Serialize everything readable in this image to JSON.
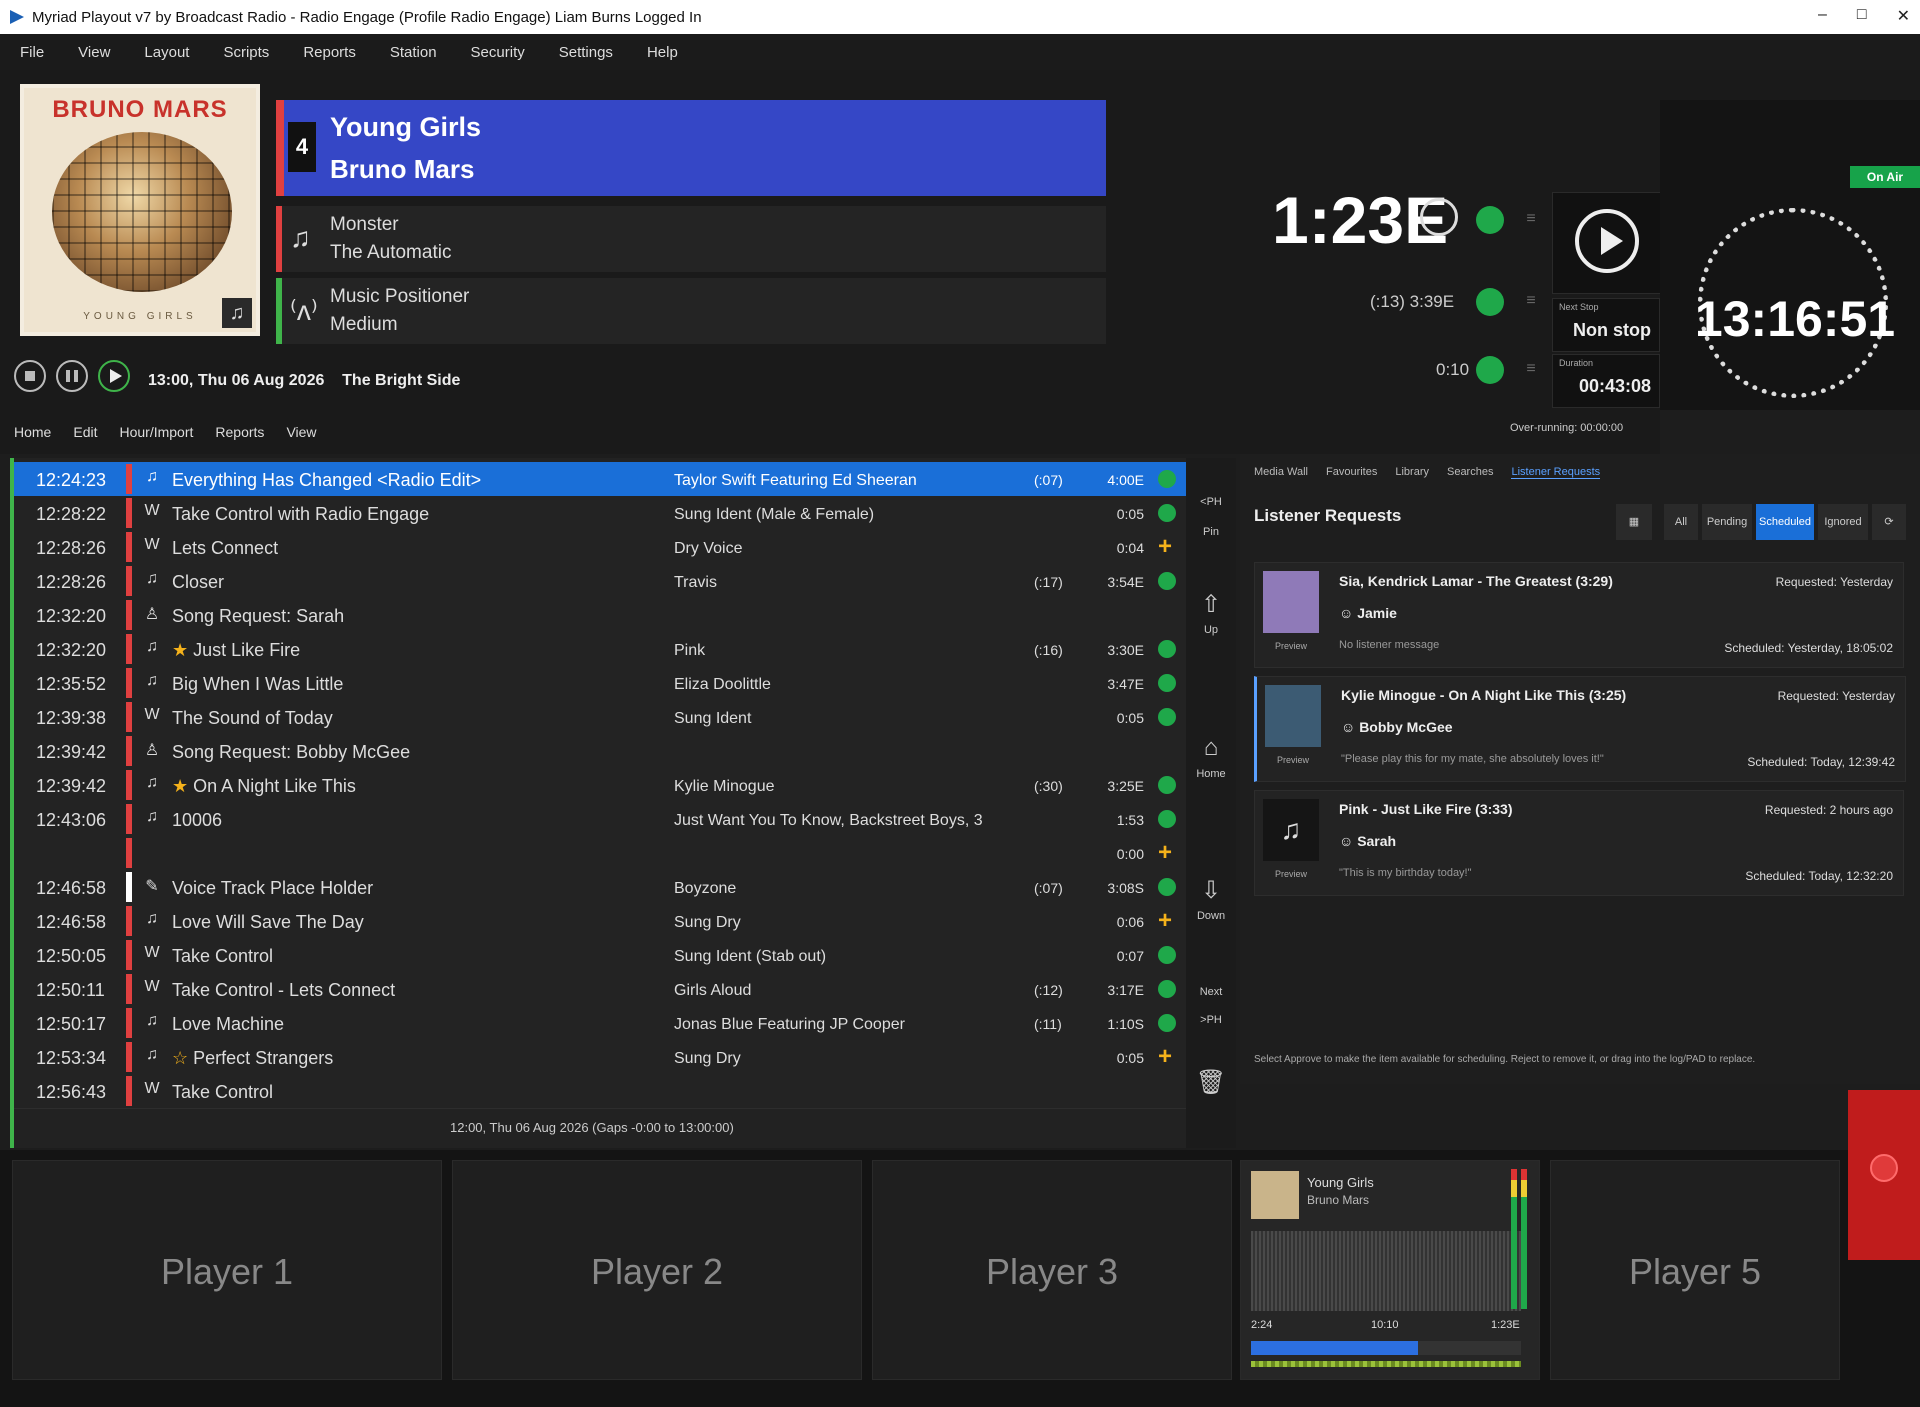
{
  "window": {
    "title": "Myriad Playout v7 by Broadcast Radio - Radio Engage (Profile Radio Engage) Liam Burns Logged In",
    "controls": [
      "–",
      "□",
      "✕"
    ]
  },
  "menu": [
    "File",
    "View",
    "Layout",
    "Scripts",
    "Reports",
    "Station",
    "Security",
    "Settings",
    "Help"
  ],
  "on_air": "On Air",
  "now_playing": {
    "album_artist": "BRUNO MARS",
    "album_sub": "YOUNG GIRLS",
    "number": "4",
    "title": "Young Girls",
    "artist": "Bruno Mars",
    "time": "1:23E",
    "next1_title": "Monster",
    "next1_sub": "The Automatic",
    "next2_title": "Music Positioner",
    "next2_sub": "Medium",
    "next1_time": "(:13) 3:39E",
    "next2_time": "0:10",
    "next_stop_label": "Next Stop",
    "next_stop": "Non stop",
    "duration_label": "Duration",
    "duration": "00:43:08",
    "clock": "13:16:51",
    "schedule_line": "13:00, Thu 06 Aug 2026",
    "show_name": "The Bright Side",
    "over_running": "Over-running: 00:00:00"
  },
  "ribbon": [
    "Home",
    "Edit",
    "Hour/Import",
    "Reports",
    "View"
  ],
  "log": {
    "rows": [
      {
        "time": "12:24:23",
        "color": "#e04040",
        "icon": "♫",
        "title": "Everything Has Changed <Radio Edit>",
        "artist": "Taylor Swift Featuring Ed Sheeran",
        "intro": "(:07)",
        "dur": "4:00E",
        "status": "green",
        "selected": true
      },
      {
        "time": "12:28:22",
        "color": "#e04040",
        "icon": "W",
        "title": "Take Control with Radio Engage",
        "artist": "Sung Ident (Male & Female)",
        "intro": "",
        "dur": "0:05",
        "status": "green"
      },
      {
        "time": "12:28:26",
        "color": "#e04040",
        "icon": "W",
        "title": "Lets Connect",
        "artist": "Dry Voice",
        "intro": "",
        "dur": "0:04",
        "status": "plus"
      },
      {
        "time": "12:28:26",
        "color": "#e04040",
        "icon": "♫",
        "title": "Closer",
        "artist": "Travis",
        "intro": "(:17)",
        "dur": "3:54E",
        "status": "green"
      },
      {
        "time": "12:32:20",
        "color": "#e04040",
        "icon": "♙",
        "title": "Song Request: Sarah",
        "artist": "",
        "intro": "",
        "dur": "",
        "status": ""
      },
      {
        "time": "12:32:20",
        "color": "#e04040",
        "icon": "♫",
        "title": "Just Like Fire",
        "star": "★",
        "artist": "Pink",
        "intro": "(:16)",
        "dur": "3:30E",
        "status": "green"
      },
      {
        "time": "12:35:52",
        "color": "#e04040",
        "icon": "♫",
        "title": "Big When I Was Little",
        "artist": "Eliza Doolittle",
        "intro": "",
        "dur": "3:47E",
        "status": "green"
      },
      {
        "time": "12:39:38",
        "color": "#e04040",
        "icon": "W",
        "title": "The Sound of Today",
        "artist": "Sung Ident",
        "intro": "",
        "dur": "0:05",
        "status": "green"
      },
      {
        "time": "12:39:42",
        "color": "#e04040",
        "icon": "♙",
        "title": "Song Request: Bobby McGee",
        "artist": "",
        "intro": "",
        "dur": "",
        "status": ""
      },
      {
        "time": "12:39:42",
        "color": "#e04040",
        "icon": "♫",
        "title": "On A Night Like This",
        "star": "★",
        "artist": "Kylie Minogue",
        "intro": "(:30)",
        "dur": "3:25E",
        "status": "green"
      },
      {
        "time": "12:43:06",
        "color": "#e04040",
        "icon": "♫",
        "title": "10006",
        "artist": "Just Want You To Know, Backstreet Boys, 3",
        "intro": "",
        "dur": "1:53",
        "status": "green"
      },
      {
        "time": "",
        "color": "#e04040",
        "icon": "",
        "title": "",
        "artist": "",
        "intro": "",
        "dur": "0:00",
        "status": "plus"
      },
      {
        "time": "12:46:58",
        "color": "#ffffff",
        "icon": "✎",
        "title": "Voice Track Place Holder",
        "artist": "Boyzone",
        "intro": "(:07)",
        "dur": "3:08S",
        "status": "green"
      },
      {
        "time": "12:46:58",
        "color": "#e04040",
        "icon": "♫",
        "title": "Love Will Save The Day",
        "artist": "Sung Dry",
        "intro": "",
        "dur": "0:06",
        "status": "plus"
      },
      {
        "time": "12:50:05",
        "color": "#e04040",
        "icon": "W",
        "title": "Take Control",
        "artist": "Sung Ident (Stab out)",
        "intro": "",
        "dur": "0:07",
        "status": "green"
      },
      {
        "time": "12:50:11",
        "color": "#e04040",
        "icon": "W",
        "title": "Take Control - Lets Connect",
        "artist": "Girls Aloud",
        "intro": "(:12)",
        "dur": "3:17E",
        "status": "green"
      },
      {
        "time": "12:50:17",
        "color": "#e04040",
        "icon": "♫",
        "title": "Love Machine",
        "artist": "Jonas Blue Featuring JP Cooper",
        "intro": "(:11)",
        "dur": "1:10S",
        "status": "green"
      },
      {
        "time": "12:53:34",
        "color": "#e04040",
        "icon": "♫",
        "title": "Perfect Strangers",
        "star": "☆",
        "artist": "Sung Dry",
        "intro": "",
        "dur": "0:05",
        "status": "plus"
      },
      {
        "time": "12:56:43",
        "color": "#e04040",
        "icon": "W",
        "title": "Take Control",
        "artist": "",
        "intro": "",
        "dur": "",
        "status": ""
      }
    ],
    "footer": "12:00, Thu 06 Aug 2026 (Gaps -0:00 to 13:00:00)"
  },
  "side_controls": {
    "prev": "<PH",
    "pin": "Pin",
    "up": "Up",
    "home": "Home",
    "down": "Down",
    "next": "Next",
    "end": ">PH"
  },
  "requests": {
    "tabs": [
      "Media Wall",
      "Favourites",
      "Library",
      "Searches",
      "Listener Requests"
    ],
    "header": "Listener Requests",
    "filters": [
      "All",
      "Pending",
      "Scheduled",
      "Ignored"
    ],
    "cards": [
      {
        "title": "Sia, Kendrick Lamar - The Greatest (3:29)",
        "user": "Jamie",
        "msg": "No listener message",
        "requested": "Requested: Yesterday",
        "scheduled": "Scheduled: Yesterday, 18:05:02",
        "preview": "Preview",
        "thumb": "#8f7ab8"
      },
      {
        "title": "Kylie Minogue - On A Night Like This (3:25)",
        "user": "Bobby McGee",
        "msg": "\"Please play this for my mate, she absolutely loves it!\"",
        "requested": "Requested: Yesterday",
        "scheduled": "Scheduled: Today, 12:39:42",
        "preview": "Preview",
        "thumb": "#3c5b73"
      },
      {
        "title": "Pink - Just Like Fire (3:33)",
        "user": "Sarah",
        "msg": "\"This is my birthday today!\"",
        "requested": "Requested: 2 hours ago",
        "scheduled": "Scheduled: Today, 12:32:20",
        "preview": "Preview",
        "thumb": "#1d1d1d"
      }
    ],
    "hint": "Select Approve to make the item available for scheduling. Reject to remove it, or drag into the log/PAD to replace."
  },
  "players": {
    "p1": "Player 1",
    "p2": "Player 2",
    "p3": "Player 3",
    "p5": "Player 5",
    "p4_title": "Young Girls",
    "p4_artist": "Bruno Mars",
    "p4_left": "2:24",
    "p4_mid": "10:10",
    "p4_right": "1:23E",
    "p4_progress": 0.62
  }
}
